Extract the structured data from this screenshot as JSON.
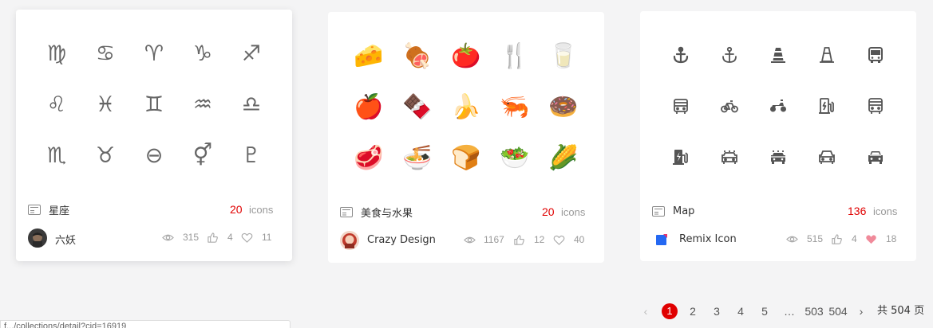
{
  "cards": [
    {
      "title": "星座",
      "count": "20",
      "count_unit": "icons",
      "author": "六妖",
      "views": "315",
      "likes": "4",
      "favorites": "11",
      "icons": [
        "♍",
        "♋",
        "♈",
        "♑",
        "♐",
        "♌",
        "♓",
        "♊",
        "♒",
        "♎",
        "♏",
        "♉",
        "⊖",
        "⚥",
        "♇"
      ],
      "icon_names": [
        "virgo-icon",
        "cancer-icon",
        "aries-icon",
        "capricorn-icon",
        "sagittarius-icon",
        "leo-icon",
        "pisces-icon",
        "gemini-icon",
        "aquarius-icon",
        "libra-icon",
        "scorpio-icon",
        "taurus-icon",
        "earth-symbol-icon",
        "venus-mars-icon",
        "pluto-icon"
      ]
    },
    {
      "title": "美食与水果",
      "count": "20",
      "count_unit": "icons",
      "author": "Crazy Design",
      "views": "1167",
      "likes": "12",
      "favorites": "40",
      "icons": [
        "🧀",
        "🍖",
        "🍅",
        "🍴",
        "🥛",
        "🍎",
        "🍫",
        "🍌",
        "🦐",
        "🍩",
        "🥩",
        "🍜",
        "🍞",
        "🥗",
        "🌽"
      ],
      "icon_names": [
        "cheese-icon",
        "ham-icon",
        "tomato-icon",
        "fork-spoon-icon",
        "milk-bottle-icon",
        "apple-icon",
        "chocolate-cake-icon",
        "banana-icon",
        "shrimp-icon",
        "donut-icon",
        "steak-icon",
        "noodle-bowl-icon",
        "bread-icon",
        "salad-bowl-icon",
        "corn-icon"
      ]
    },
    {
      "title": "Map",
      "count": "136",
      "count_unit": "icons",
      "author": "Remix Icon",
      "views": "515",
      "likes": "4",
      "favorites": "18",
      "icon_names": [
        "anchor-fill-icon",
        "anchor-line-icon",
        "traffic-cone-fill-icon",
        "traffic-cone-line-icon",
        "bus-fill-icon",
        "bus-line-icon",
        "bike-line-icon",
        "motorbike-fill-icon",
        "charging-pile-line-icon",
        "bus-2-line-icon",
        "charging-pile-fill-icon",
        "taxi-line-icon",
        "taxi-fill-icon",
        "car-line-icon",
        "car-fill-icon"
      ]
    }
  ],
  "pagination": {
    "prev": "‹",
    "pages": [
      "1",
      "2",
      "3",
      "4",
      "5",
      "…",
      "503",
      "504"
    ],
    "next": "›",
    "total": "共 504 页",
    "active": "1"
  },
  "status_url": "f.../collections/detail?cid=16919",
  "colors": {
    "accent": "#e00000",
    "icon_gray": "#666666",
    "meta_gray": "#999999"
  }
}
